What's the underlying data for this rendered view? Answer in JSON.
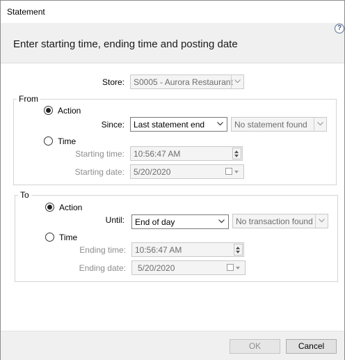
{
  "window": {
    "title": "Statement"
  },
  "header": {
    "heading": "Enter starting time, ending time and posting date",
    "help_glyph": "?"
  },
  "store": {
    "label": "Store:",
    "value": "S0005 - Aurora Restaurant"
  },
  "from": {
    "legend": "From",
    "action_label": "Action",
    "time_label": "Time",
    "selected": "Action",
    "since_label": "Since:",
    "since_value": "Last statement end",
    "status_value": "No statement found",
    "starting_time_label": "Starting time:",
    "starting_time_value": "10:56:47 AM",
    "starting_date_label": "Starting date:",
    "starting_date_value": "5/20/2020"
  },
  "to": {
    "legend": "To",
    "action_label": "Action",
    "time_label": "Time",
    "selected": "Action",
    "until_label": "Until:",
    "until_value": "End of day",
    "status_value": "No transaction found",
    "ending_time_label": "Ending time:",
    "ending_time_value": "10:56:47 AM",
    "ending_date_label": "Ending date:",
    "ending_date_value": "5/20/2020"
  },
  "footer": {
    "ok_label": "OK",
    "cancel_label": "Cancel"
  },
  "colors": {
    "header_bg": "#f0f0f0",
    "disabled_text": "#8d8d8d",
    "help_icon": "#3c5a85"
  },
  "icons": [
    "help-icon",
    "chevron-down-icon",
    "spin-arrows-icon",
    "calendar-icon"
  ]
}
